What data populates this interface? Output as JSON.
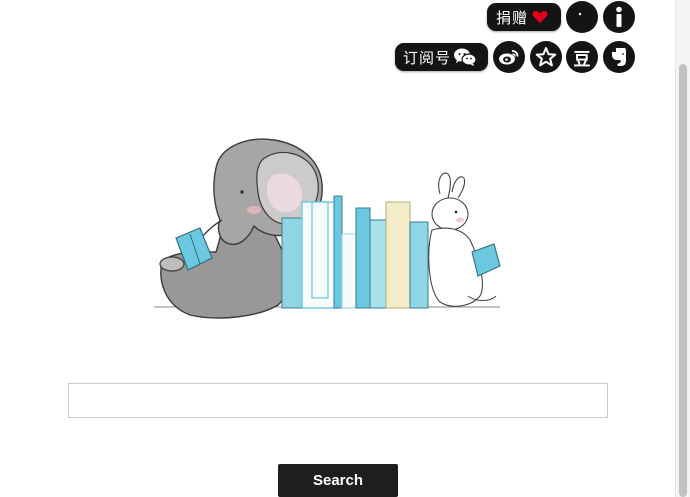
{
  "header": {
    "donate_label": "捐赠",
    "subscribe_label": "订阅号",
    "icons": [
      "heart-icon",
      "moon-icon",
      "info-icon",
      "wechat-icon",
      "weibo-icon",
      "star-icon",
      "douban-icon",
      "evernote-icon"
    ],
    "douban_glyph": "豆"
  },
  "search": {
    "value": "",
    "placeholder": "",
    "button_label": "Search"
  },
  "colors": {
    "button_bg": "#1e1e1e",
    "heart": "#e0001b",
    "book_blue": "#6cc8e0",
    "book_cream": "#f3ecc8"
  }
}
